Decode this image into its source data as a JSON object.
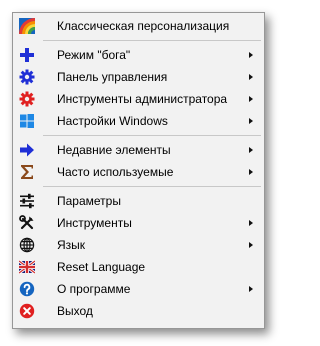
{
  "menu": {
    "items": [
      {
        "label": "Классическая персонализация",
        "icon": "rainbow-icon",
        "submenu": false
      },
      {
        "label": "Режим \"бога\"",
        "icon": "plus-icon",
        "submenu": true
      },
      {
        "label": "Панель управления",
        "icon": "gear-icon",
        "submenu": true
      },
      {
        "label": "Инструменты администратора",
        "icon": "gear-red-icon",
        "submenu": true
      },
      {
        "label": "Настройки Windows",
        "icon": "windows-icon",
        "submenu": true
      },
      {
        "label": "Недавние элементы",
        "icon": "arrow-right-icon",
        "submenu": true
      },
      {
        "label": "Часто используемые",
        "icon": "sigma-icon",
        "submenu": true
      },
      {
        "label": "Параметры",
        "icon": "sliders-icon",
        "submenu": false
      },
      {
        "label": "Инструменты",
        "icon": "tools-icon",
        "submenu": true
      },
      {
        "label": "Язык",
        "icon": "globe-icon",
        "submenu": true
      },
      {
        "label": "Reset Language",
        "icon": "uk-flag-icon",
        "submenu": false
      },
      {
        "label": "О программе",
        "icon": "help-icon",
        "submenu": true
      },
      {
        "label": "Выход",
        "icon": "exit-icon",
        "submenu": false
      }
    ]
  },
  "colors": {
    "menu_bg": "#f2f2f2",
    "icon_blue": "#1f2fd6",
    "icon_red": "#e02020",
    "windows_blue": "#1e88e5"
  }
}
